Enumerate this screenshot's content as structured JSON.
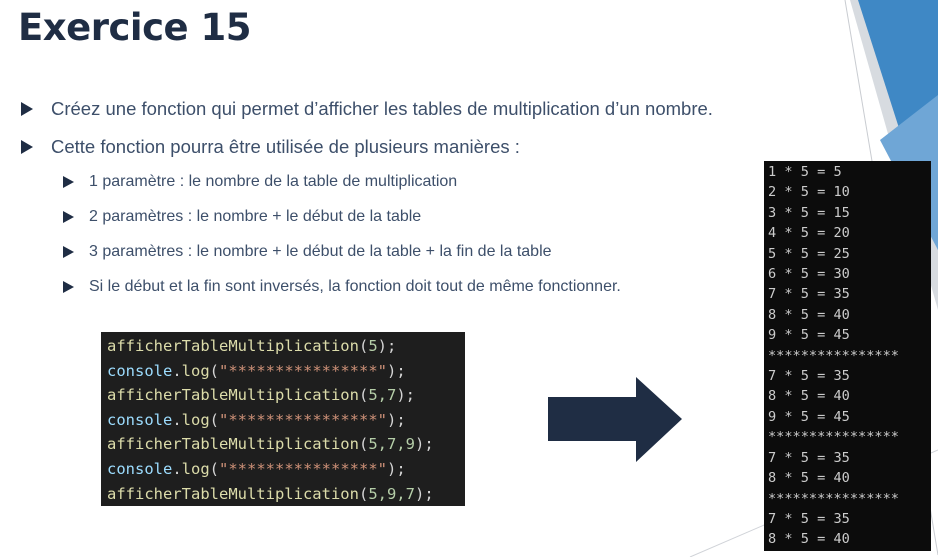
{
  "slide": {
    "title": "Exercice 15",
    "bullets": [
      "Créez une fonction qui permet d’afficher les tables de multiplication d’un nombre.",
      "Cette fonction pourra être utilisée de plusieurs manières :"
    ],
    "sub_bullets": [
      "1 paramètre : le nombre de la table de multiplication",
      "2 paramètres : le nombre + le début de la table",
      "3 paramètres : le nombre + le début de la table + la fin de la table",
      "Si le début et la fin sont inversés, la fonction doit tout de même fonctionner."
    ]
  },
  "code_lines": [
    {
      "kind": "call",
      "fn": "afficherTableMultiplication",
      "args": "5"
    },
    {
      "kind": "log",
      "obj": "console",
      "method": "log",
      "str": "\"****************\""
    },
    {
      "kind": "call",
      "fn": "afficherTableMultiplication",
      "args": "5,7"
    },
    {
      "kind": "log",
      "obj": "console",
      "method": "log",
      "str": "\"****************\""
    },
    {
      "kind": "call",
      "fn": "afficherTableMultiplication",
      "args": "5,7,9"
    },
    {
      "kind": "log",
      "obj": "console",
      "method": "log",
      "str": "\"****************\""
    },
    {
      "kind": "call",
      "fn": "afficherTableMultiplication",
      "args": "5,9,7"
    }
  ],
  "console_output": [
    "1 * 5 = 5",
    "2 * 5 = 10",
    "3 * 5 = 15",
    "4 * 5 = 20",
    "5 * 5 = 25",
    "6 * 5 = 30",
    "7 * 5 = 35",
    "8 * 5 = 40",
    "9 * 5 = 45",
    "****************",
    "7 * 5 = 35",
    "8 * 5 = 40",
    "9 * 5 = 45",
    "****************",
    "7 * 5 = 35",
    "8 * 5 = 40",
    "****************",
    "7 * 5 = 35",
    "8 * 5 = 40"
  ],
  "colors": {
    "title": "#1f2d44",
    "text": "#3d4f6a",
    "arrow": "#1f2d44",
    "accent_blue": "#3f88c5"
  }
}
